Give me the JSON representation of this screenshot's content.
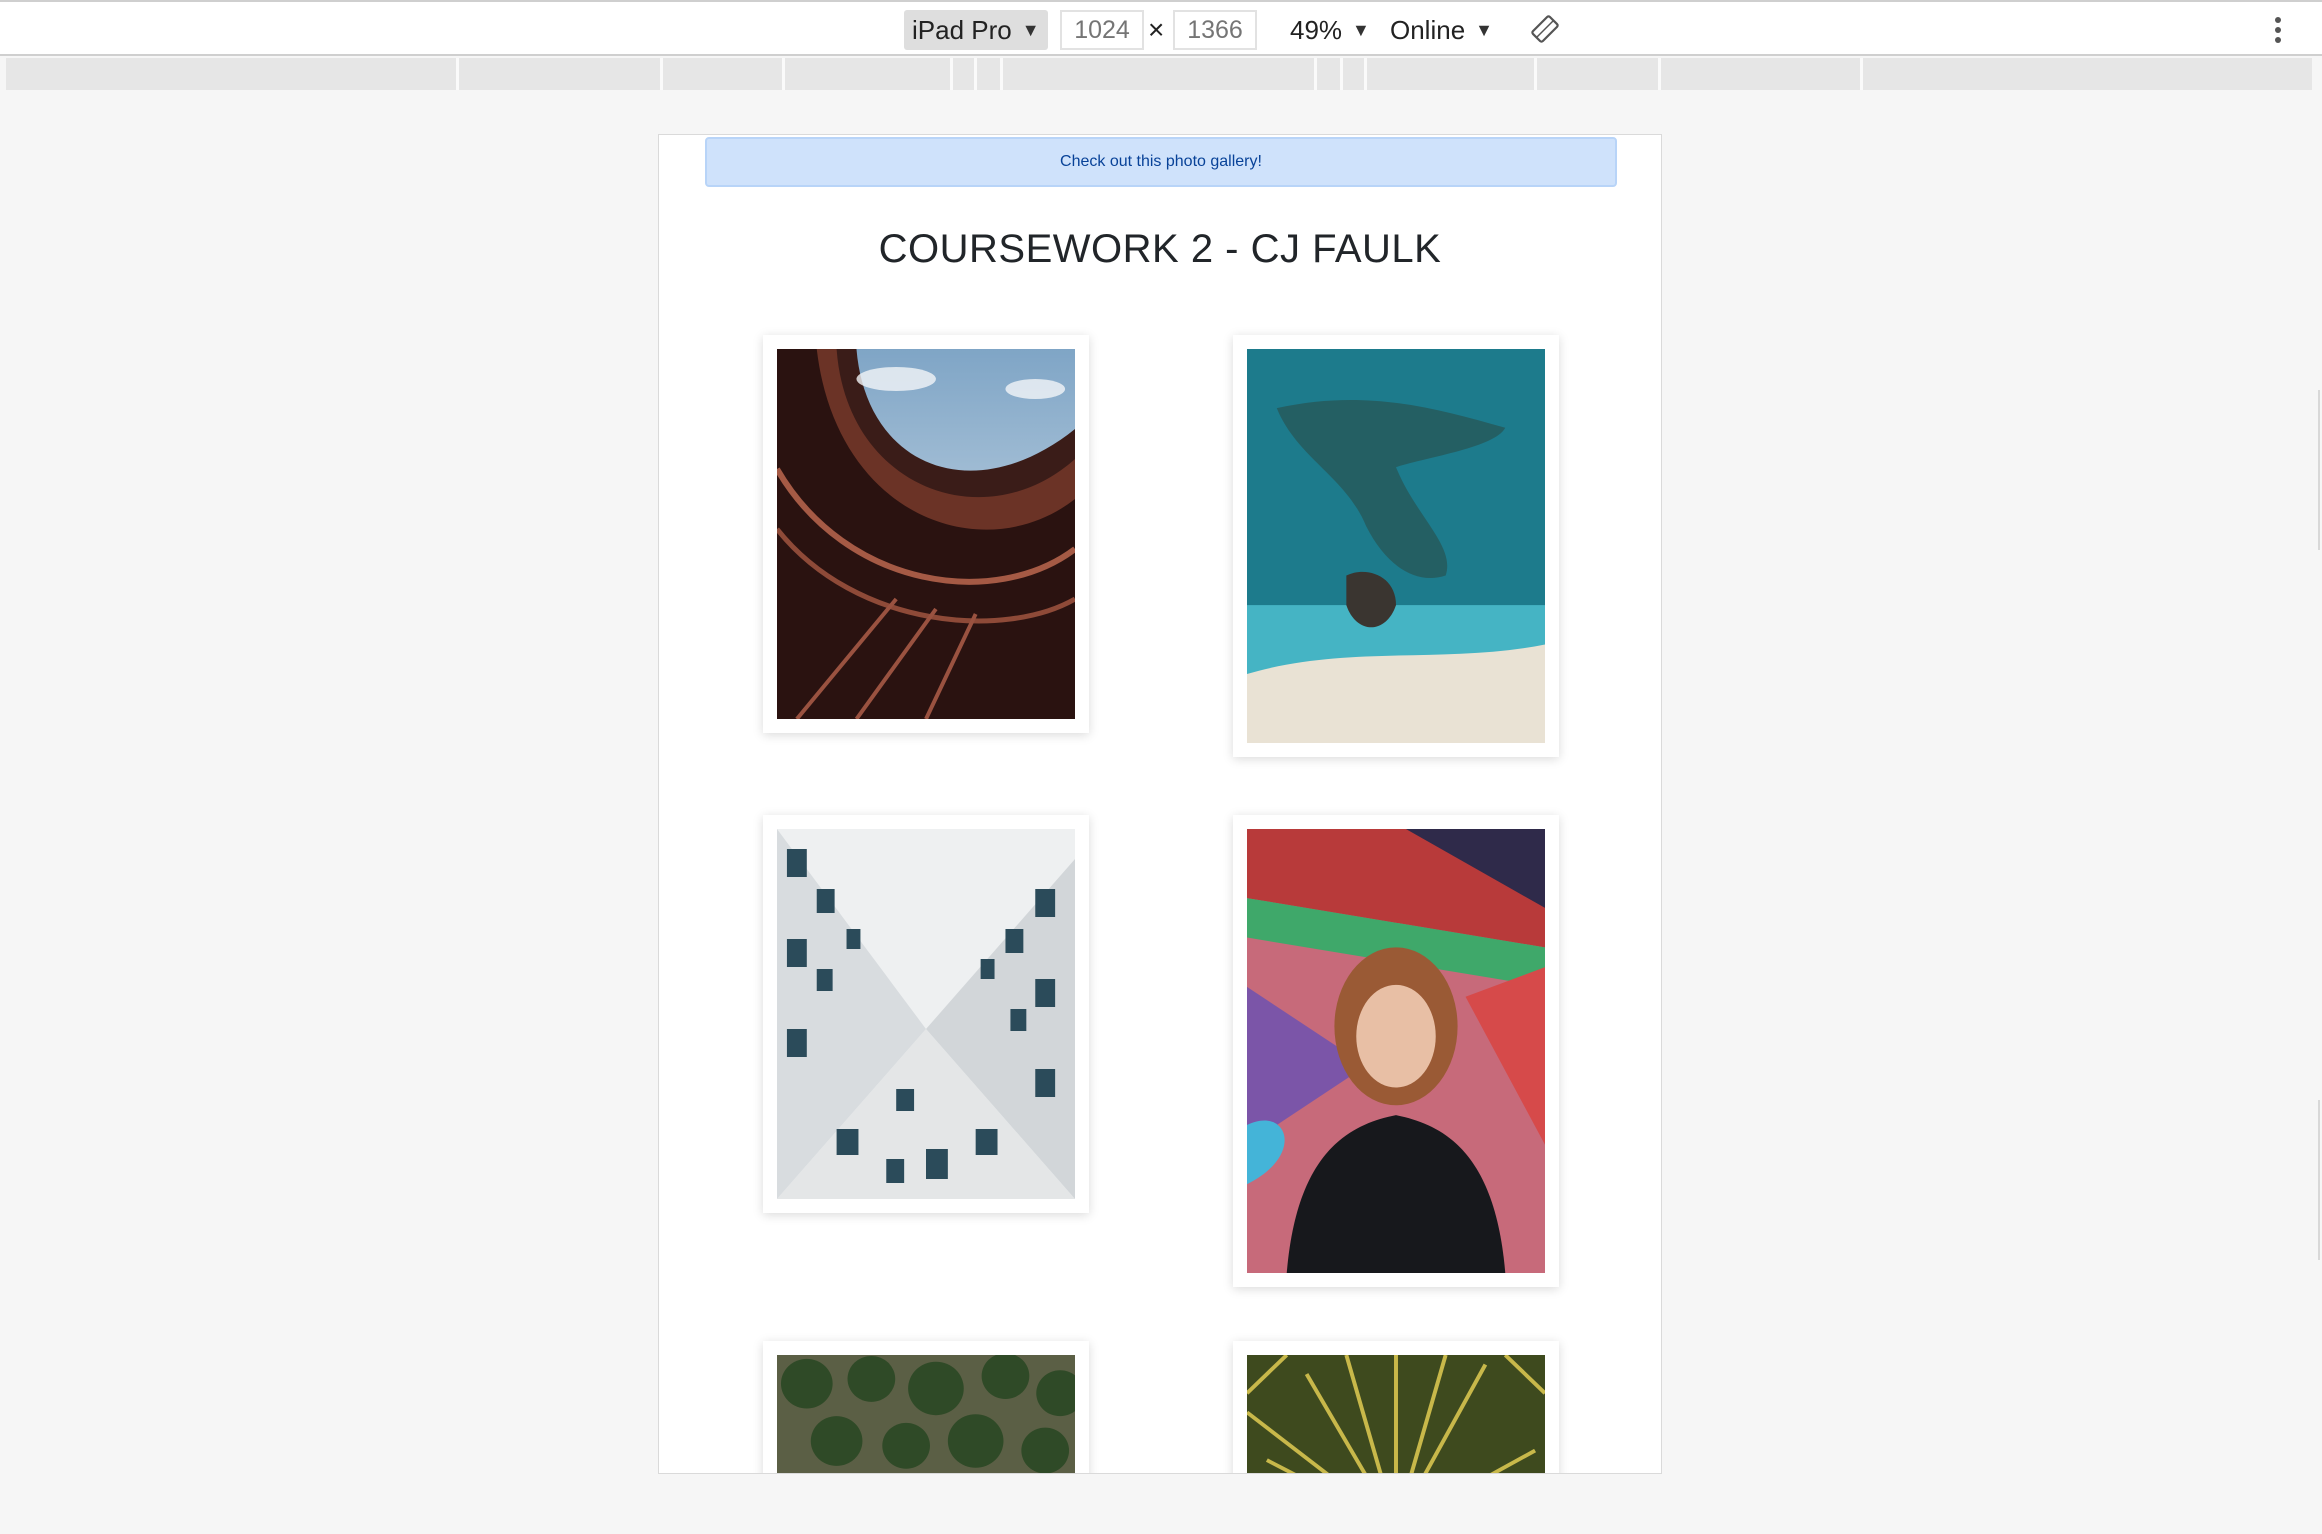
{
  "toolbar": {
    "device": "iPad Pro",
    "width_placeholder": "1024",
    "height_placeholder": "1366",
    "dimension_separator": "×",
    "zoom": "49%",
    "network": "Online"
  },
  "page": {
    "alert_text": "Check out this photo gallery!",
    "title": "COURSEWORK 2 - CJ FAULK"
  },
  "gallery": [
    {
      "icon": "curved-building-photo"
    },
    {
      "icon": "aerial-coast-photo"
    },
    {
      "icon": "building-courtyard-photo"
    },
    {
      "icon": "portrait-graffiti-photo"
    },
    {
      "icon": "palm-trees-aerial-photo"
    },
    {
      "icon": "plant-closeup-photo"
    }
  ],
  "colors": {
    "alert_bg": "#cfe2fb",
    "alert_text": "#084298",
    "title": "#212529"
  }
}
